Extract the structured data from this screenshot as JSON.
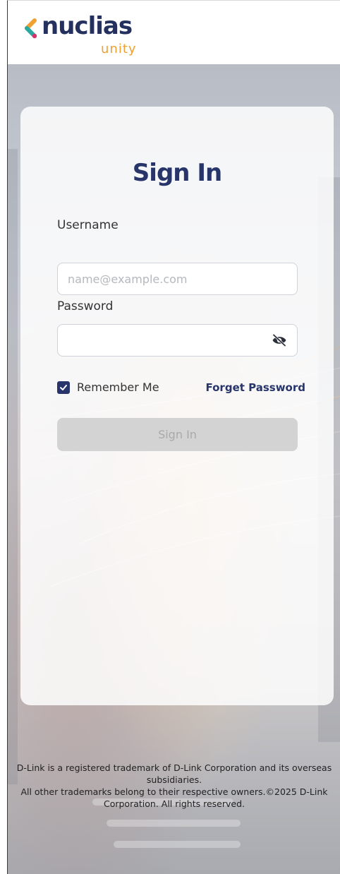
{
  "header": {
    "logo_main": "nuclias",
    "logo_sub": "unity"
  },
  "login": {
    "title": "Sign In",
    "username_label": "Username",
    "username_placeholder": "name@example.com",
    "password_label": "Password",
    "password_value": "",
    "remember_label": "Remember Me",
    "remember_checked": true,
    "forget_password": "Forget Password",
    "submit_label": "Sign In"
  },
  "footer": {
    "line1": "D-Link is a registered trademark of D-Link Corporation and its overseas subsidiaries.",
    "line2": "All other trademarks belong to their respective owners.©2025 D-Link Corporation. All rights reserved."
  },
  "colors": {
    "brand_navy": "#27356b",
    "brand_orange": "#f0a030",
    "button_disabled": "#d3d3d3"
  },
  "icons": {
    "password_toggle": "eye-slash-icon",
    "checkbox": "check-icon",
    "logo_mark": "chevron-left-icon"
  }
}
